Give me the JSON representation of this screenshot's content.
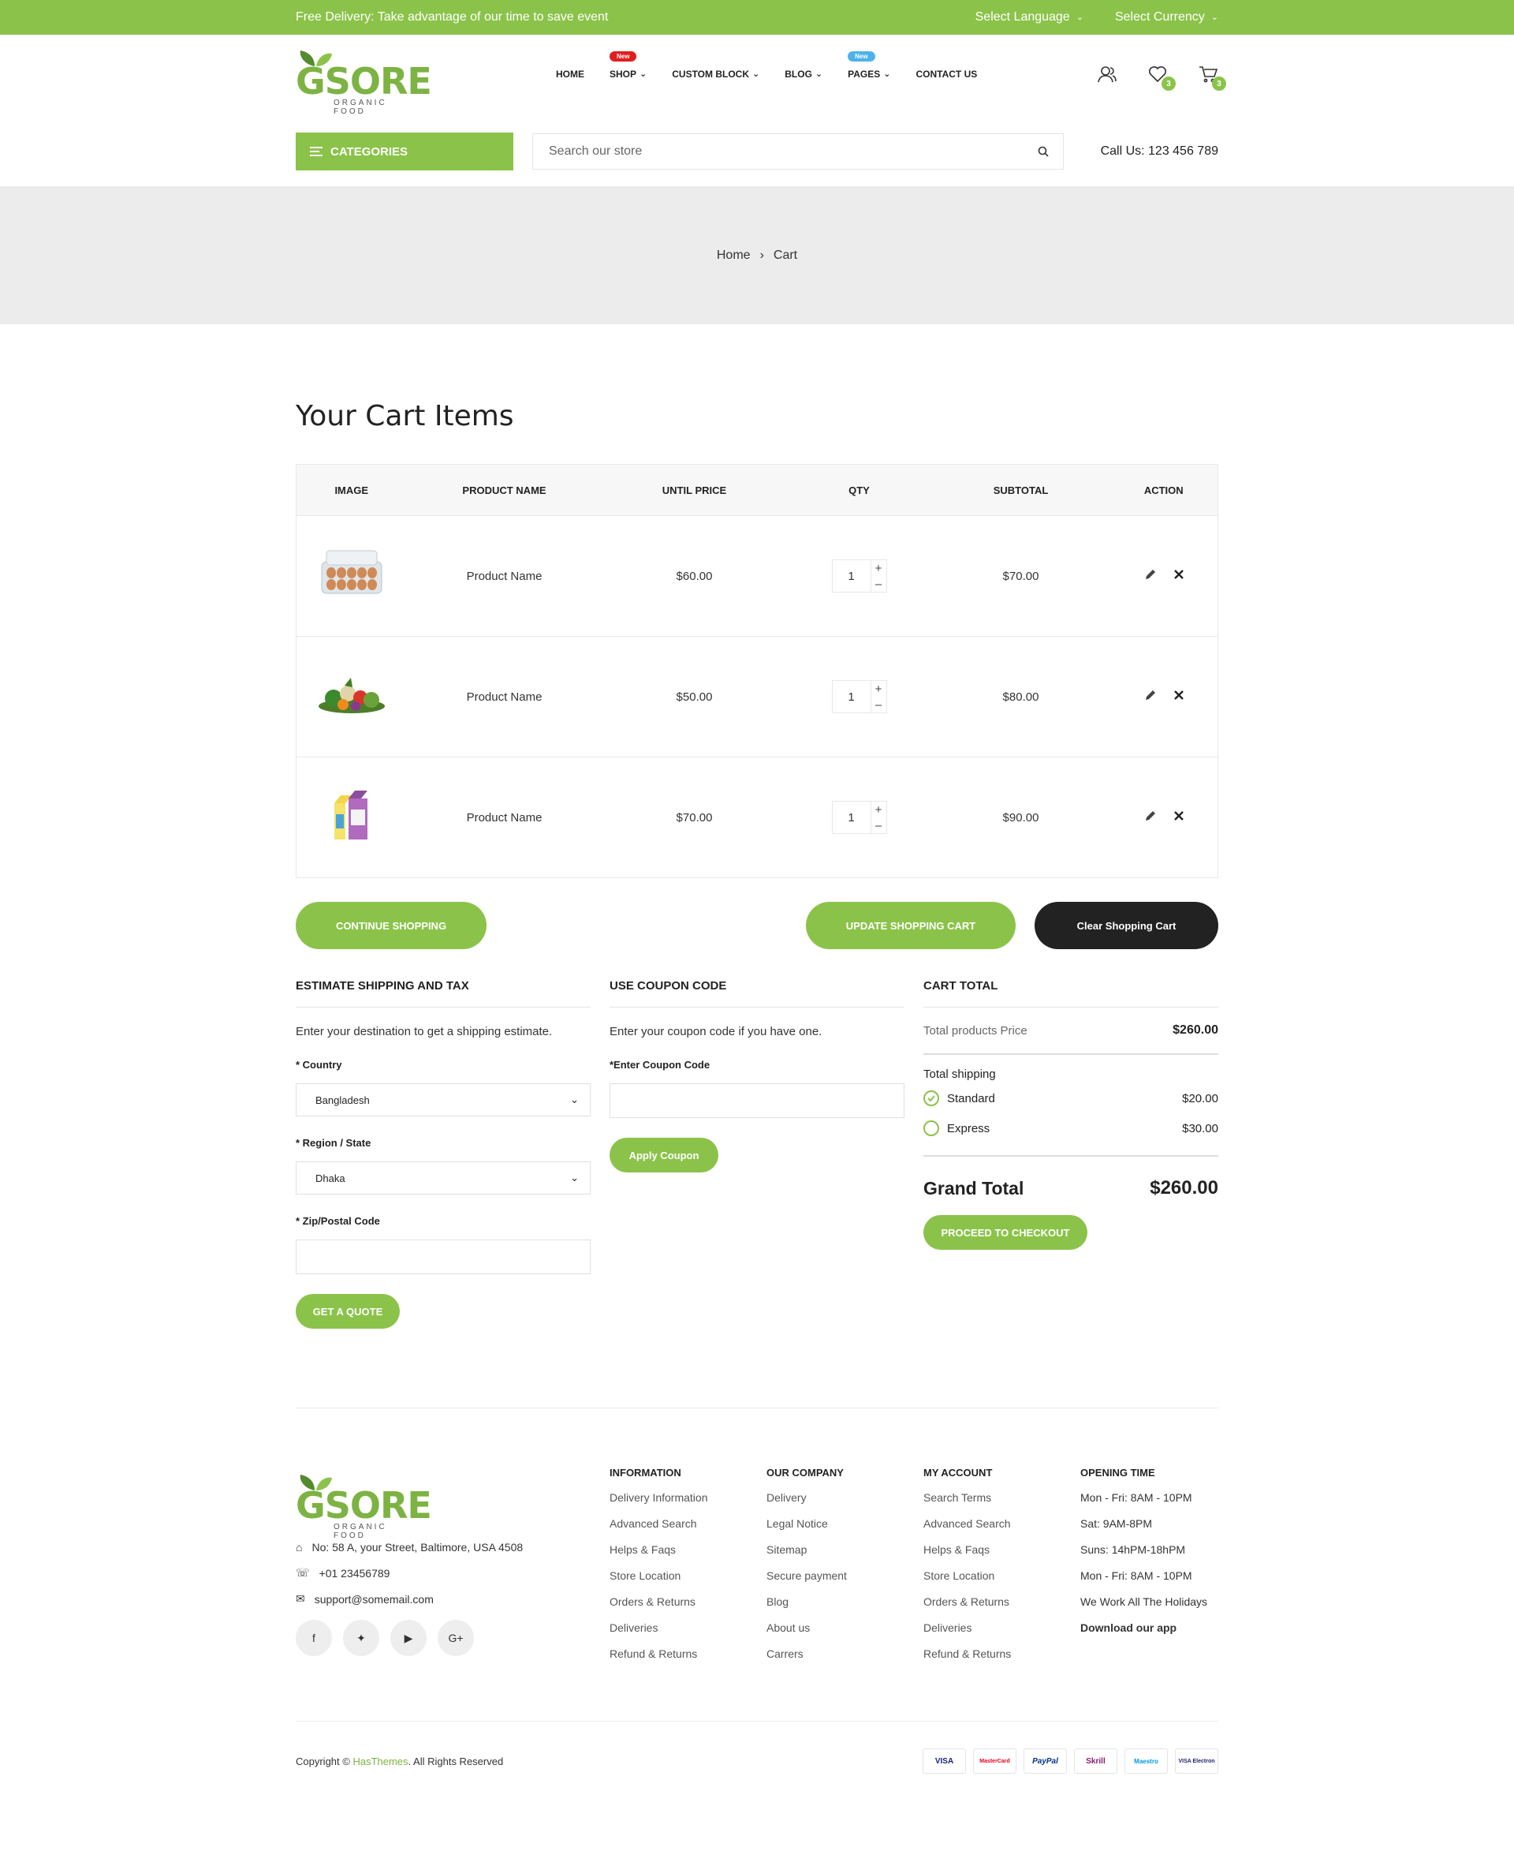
{
  "topbar": {
    "promo": "Free Delivery: Take advantage of our time to save event",
    "language": "Select Language",
    "currency": "Select Currency"
  },
  "brand": {
    "name": "GSORE",
    "tagline": "ORGANIC FOOD",
    "accent": "#8bc34a"
  },
  "nav": {
    "items": [
      {
        "label": "HOME"
      },
      {
        "label": "SHOP",
        "badge": "New"
      },
      {
        "label": "CUSTOM BLOCK"
      },
      {
        "label": "BLOG"
      },
      {
        "label": "PAGES",
        "badge": "New"
      },
      {
        "label": "CONTACT US"
      }
    ]
  },
  "header": {
    "wishlist_count": "3",
    "cart_count": "3"
  },
  "categories_label": "CATEGORIES",
  "search": {
    "placeholder": "Search our store"
  },
  "call_us": "Call Us: 123 456 789",
  "breadcrumb": {
    "home": "Home",
    "current": "Cart"
  },
  "cart": {
    "title": "Your Cart Items",
    "columns": [
      "IMAGE",
      "PRODUCT NAME",
      "UNTIL PRICE",
      "QTY",
      "SUBTOTAL",
      "ACTION"
    ],
    "rows": [
      {
        "image": "eggs",
        "name": "Product Name",
        "price": "$60.00",
        "qty": "1",
        "subtotal": "$70.00"
      },
      {
        "image": "vegetables",
        "name": "Product Name",
        "price": "$50.00",
        "qty": "1",
        "subtotal": "$80.00"
      },
      {
        "image": "milk",
        "name": "Product Name",
        "price": "$70.00",
        "qty": "1",
        "subtotal": "$90.00"
      }
    ],
    "continue_label": "CONTINUE SHOPPING",
    "update_label": "UPDATE SHOPPING CART",
    "clear_label": "Clear Shopping Cart"
  },
  "shipping": {
    "title": "ESTIMATE SHIPPING AND TAX",
    "desc": "Enter your destination to get a shipping estimate.",
    "country_label": "* Country",
    "country_value": "Bangladesh",
    "region_label": "* Region / State",
    "region_value": "Dhaka",
    "zip_label": "* Zip/Postal Code",
    "button": "GET A QUOTE"
  },
  "coupon": {
    "title": "USE COUPON CODE",
    "desc": "Enter your coupon code if you have one.",
    "label": "*Enter Coupon Code",
    "button": "Apply Coupon"
  },
  "totals": {
    "title": "CART TOTAL",
    "products_label": "Total products Price",
    "products_value": "$260.00",
    "shipping_label": "Total shipping",
    "standard_label": "Standard",
    "standard_value": "$20.00",
    "express_label": "Express",
    "express_value": "$30.00",
    "grand_label": "Grand Total",
    "grand_value": "$260.00",
    "checkout_label": "PROCEED TO CHECKOUT"
  },
  "footer": {
    "address": "No: 58 A, your Street, Baltimore, USA 4508",
    "phone": "+01 23456789",
    "email": "support@somemail.com",
    "social": [
      "facebook-icon",
      "twitter-icon",
      "youtube-icon",
      "google-plus-icon"
    ],
    "columns": [
      {
        "title": "INFORMATION",
        "links": [
          "Delivery Information",
          "Advanced Search",
          "Helps & Faqs",
          "Store Location",
          "Orders & Returns",
          "Deliveries",
          "Refund & Returns"
        ]
      },
      {
        "title": "OUR COMPANY",
        "links": [
          "Delivery",
          "Legal Notice",
          "Sitemap",
          "Secure payment",
          "Blog",
          "About us",
          "Carrers"
        ]
      },
      {
        "title": "MY ACCOUNT",
        "links": [
          "Search Terms",
          "Advanced Search",
          "Helps & Faqs",
          "Store Location",
          "Orders & Returns",
          "Deliveries",
          "Refund & Returns"
        ]
      },
      {
        "title": "OPENING TIME",
        "links": [
          "Mon - Fri: 8AM - 10PM",
          "Sat: 9AM-8PM",
          "Suns: 14hPM-18hPM",
          "Mon - Fri: 8AM - 10PM",
          "We Work All The Holidays",
          "Download our app"
        ]
      }
    ],
    "copyright_prefix": "Copyright ©",
    "copyright_link": "HasThemes",
    "copyright_suffix": ". All Rights Reserved",
    "payments": [
      "VISA",
      "MasterCard",
      "PayPal",
      "Skrill",
      "Maestro",
      "VISA Electron"
    ]
  }
}
